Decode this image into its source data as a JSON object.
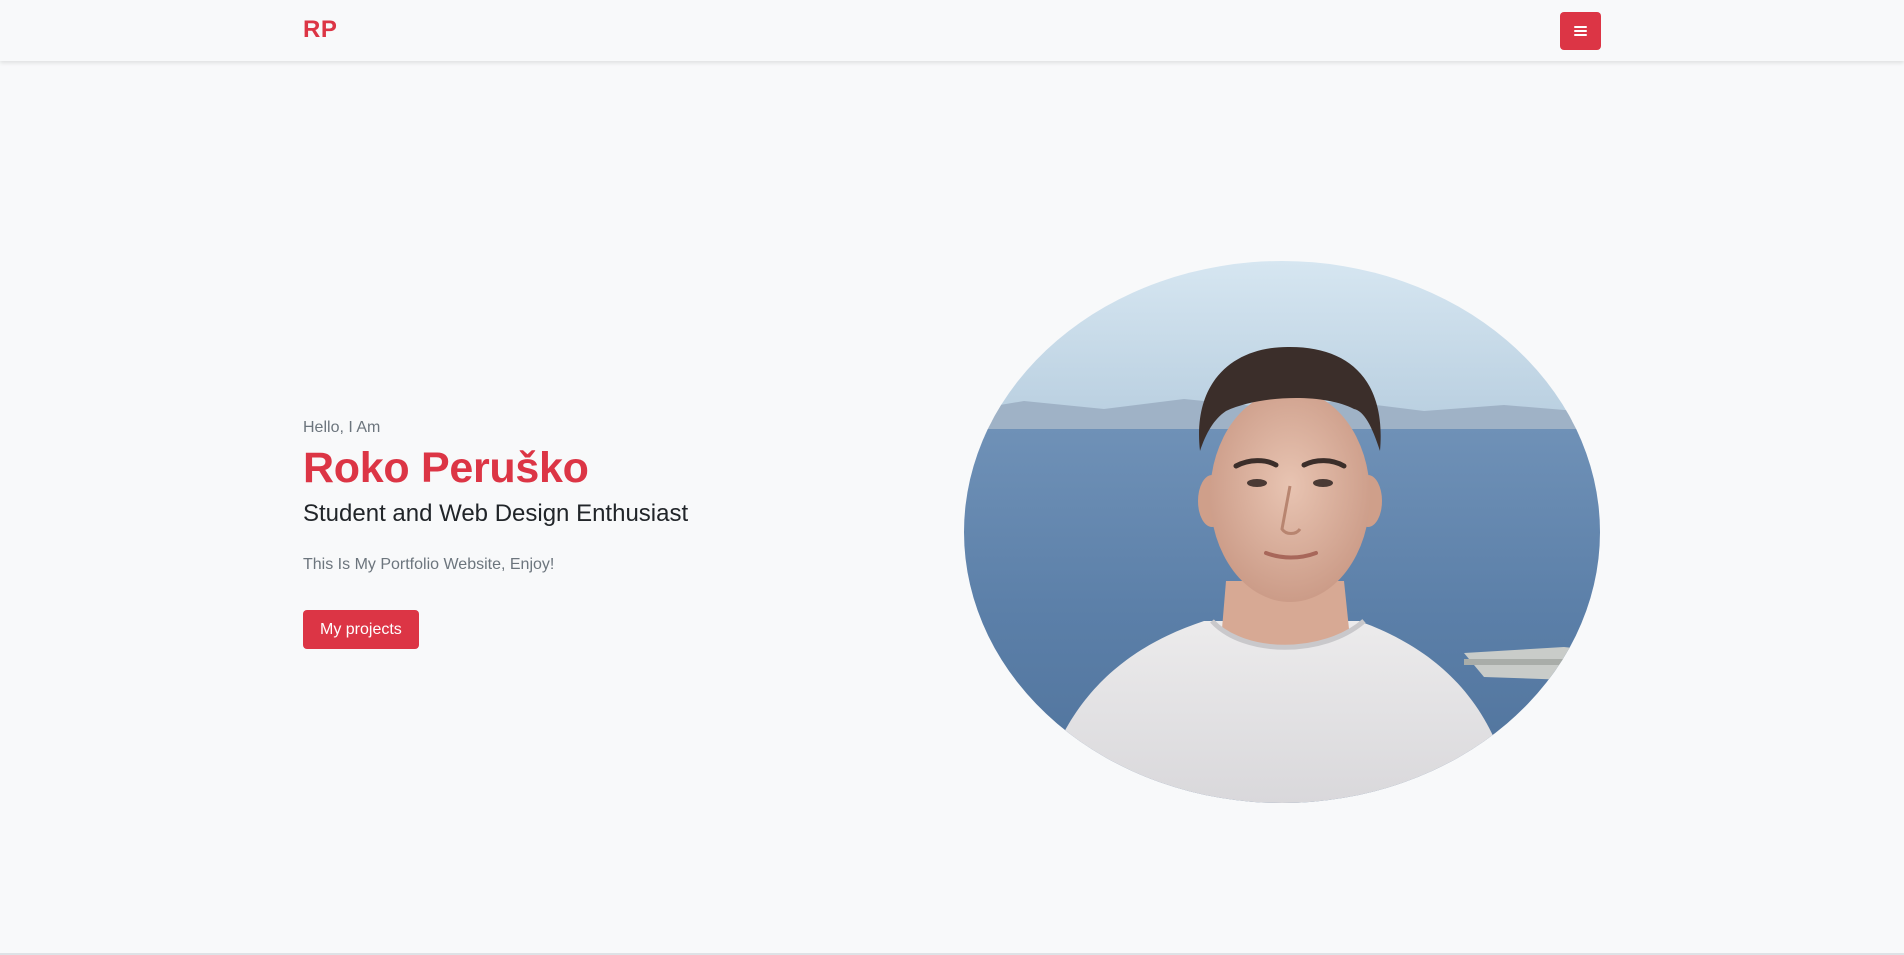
{
  "navbar": {
    "brand": "RP",
    "menu_icon": "hamburger-menu-icon"
  },
  "hero": {
    "greeting": "Hello, I Am",
    "name": "Roko Peruško",
    "role": "Student and Web Design Enthusiast",
    "tagline": "This Is My Portfolio Website, Enjoy!",
    "cta_label": "My projects"
  },
  "colors": {
    "accent": "#dc3545",
    "background": "#f8f9fa",
    "text_dark": "#212529",
    "text_muted": "#6c757d"
  }
}
